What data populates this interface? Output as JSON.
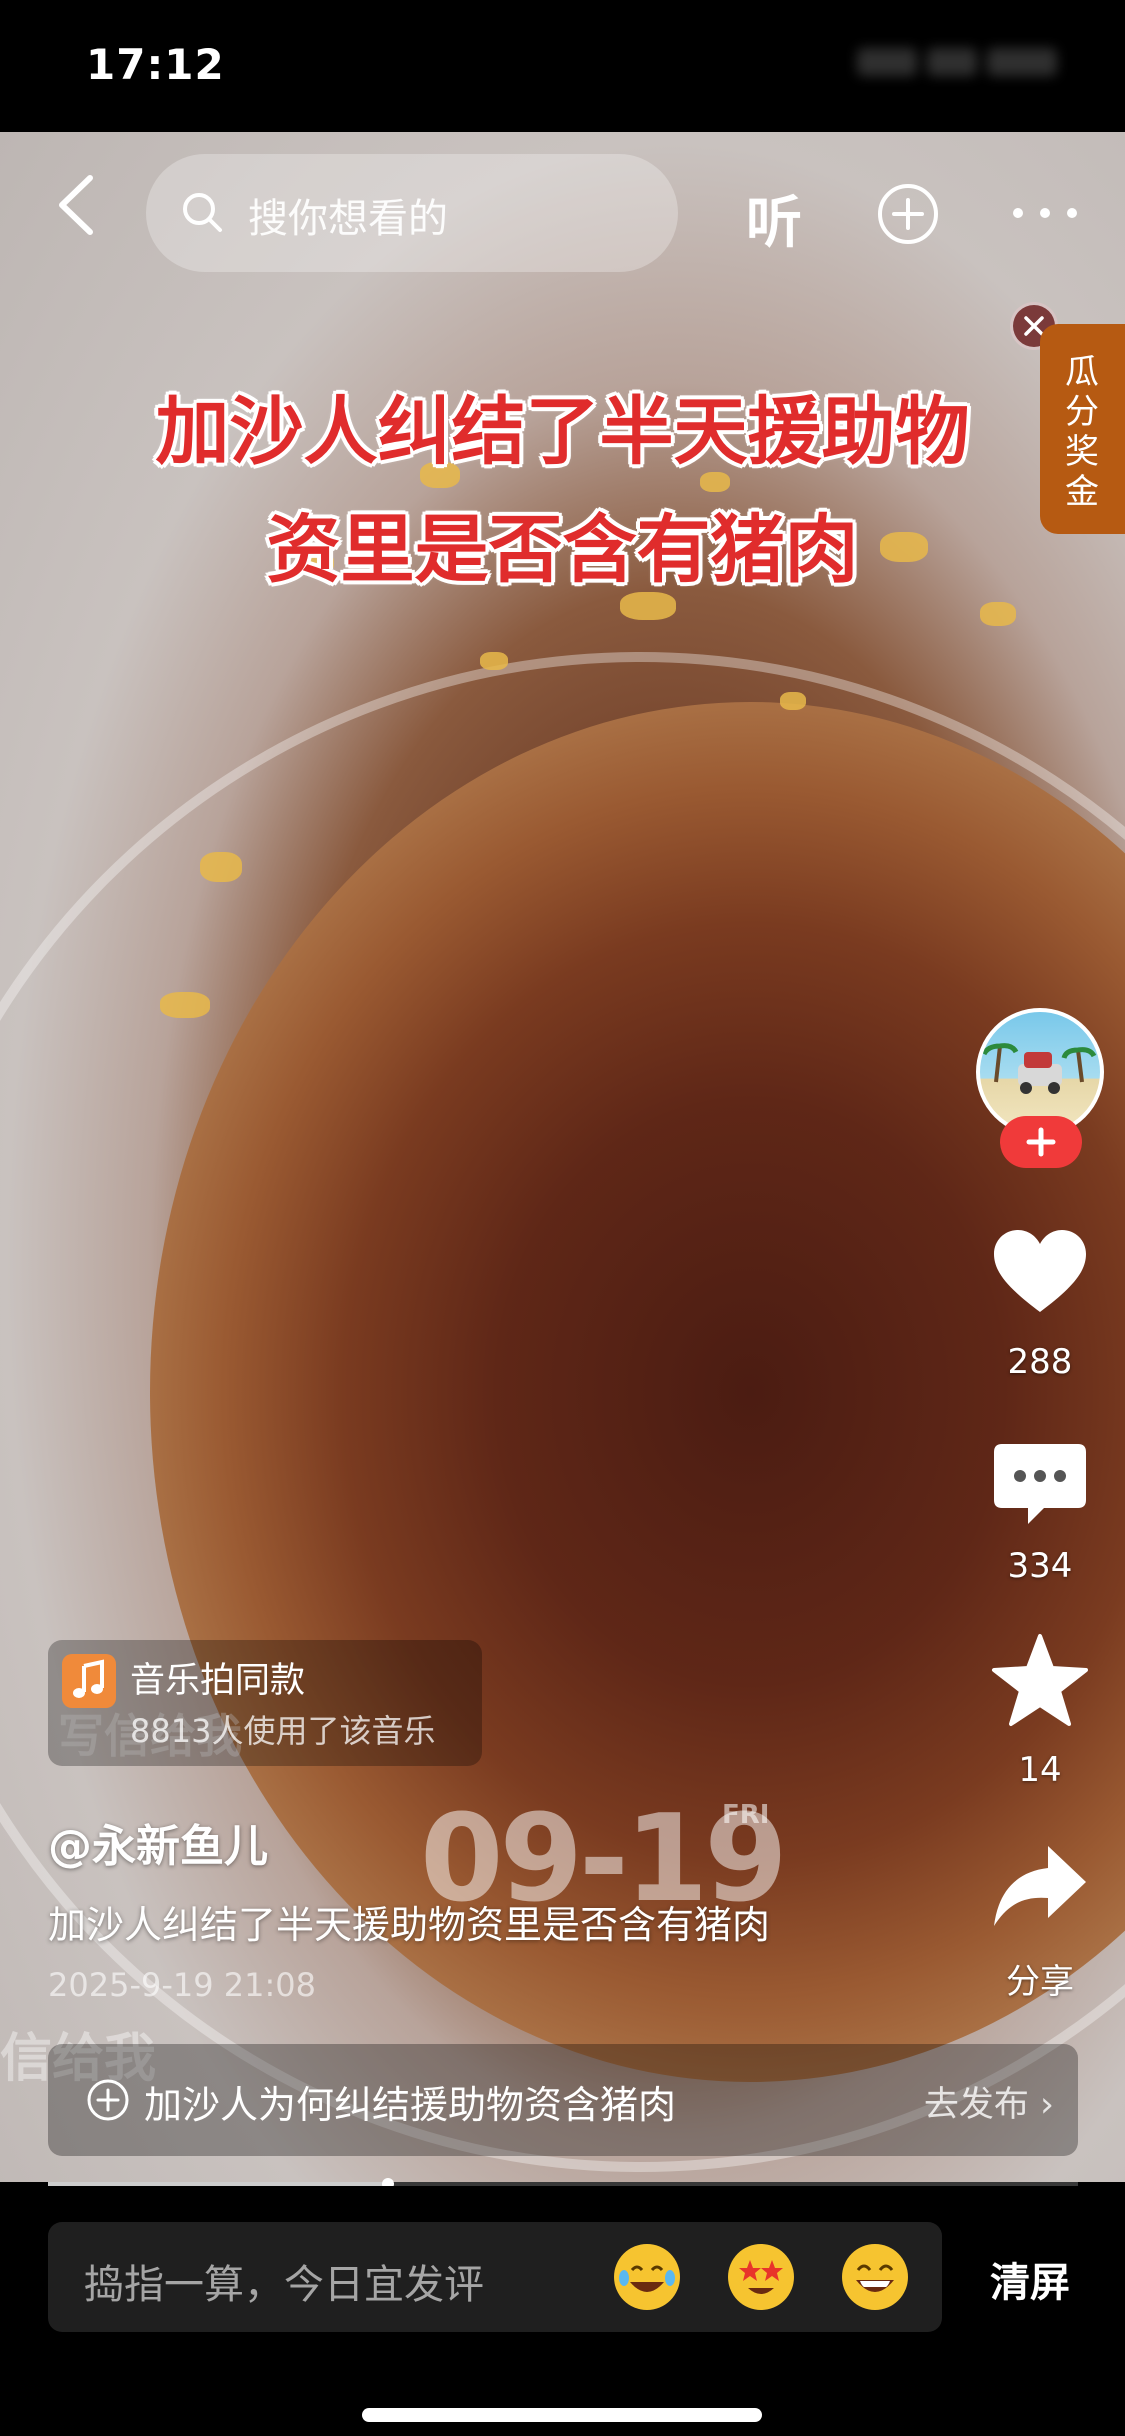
{
  "status_bar": {
    "time": "17:12"
  },
  "top_bar": {
    "search_placeholder": "搜你想看的",
    "listen_label": "听",
    "back_icon": "back-chevron-icon",
    "add_icon": "plus-circle-icon",
    "more_icon": "more-dots-icon"
  },
  "video": {
    "title_line1": "加沙人纠结了半天援助物",
    "title_line2": "资里是否含有猪肉",
    "watermark1": "写信给我",
    "watermark2": "信给我",
    "date_overlay": "09-19",
    "date_day": "FRI"
  },
  "reward_badge": {
    "label": "瓜分奖金"
  },
  "side_actions": {
    "likes": "288",
    "comments": "334",
    "favorites": "14",
    "share_label": "分享"
  },
  "music": {
    "title": "音乐拍同款",
    "usage": "8813人使用了该音乐"
  },
  "post": {
    "author": "@永新鱼儿",
    "description": "加沙人纠结了半天援助物资里是否含有猪肉",
    "timestamp": "2025-9-19 21:08"
  },
  "topic": {
    "text": "加沙人为何纠结援助物资含猪肉",
    "action": "去发布"
  },
  "playback": {
    "progress_fraction": 0.33
  },
  "bottom_bar": {
    "comment_placeholder": "捣指一算，今日宜发评",
    "clear_label": "清屏"
  },
  "colors": {
    "title_red": "#e02c2c",
    "reward_orange": "#b65a12",
    "follow_red": "#f03a3a"
  }
}
